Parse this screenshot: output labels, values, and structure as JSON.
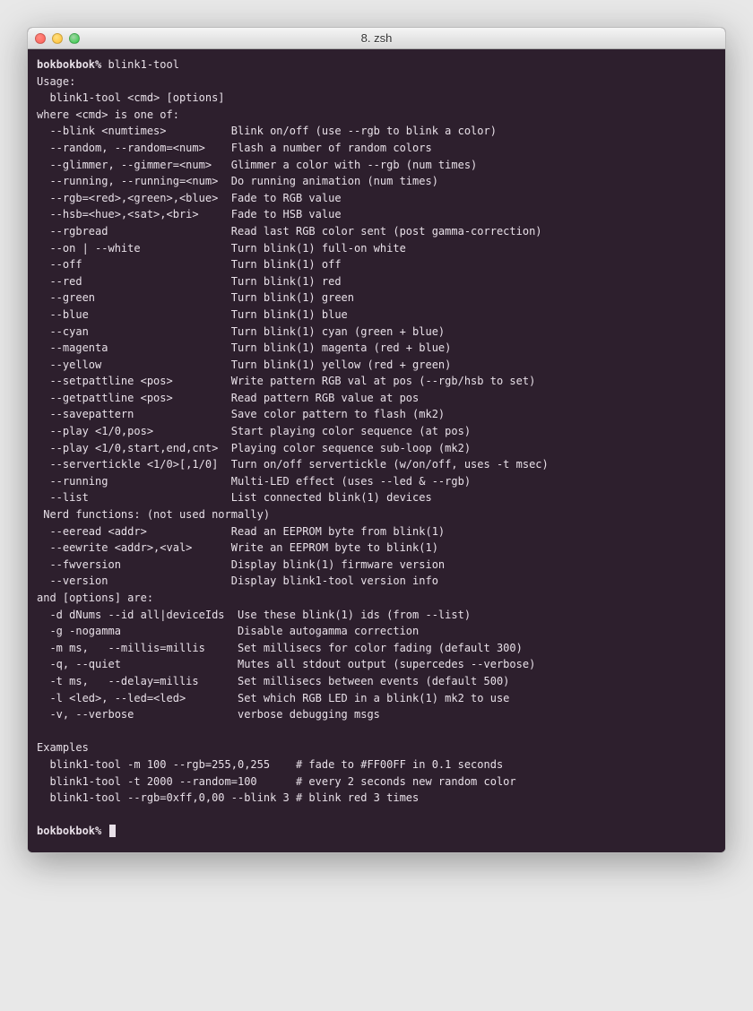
{
  "window": {
    "title": "8. zsh"
  },
  "prompt1": {
    "host": "bokbokbok%",
    "cmd": " blink1-tool"
  },
  "usage_header": "Usage:",
  "usage_line": "  blink1-tool <cmd> [options]",
  "where_header": "where <cmd> is one of:",
  "cmds": [
    {
      "flag": "  --blink <numtimes>        ",
      "desc": "Blink on/off (use --rgb to blink a color)"
    },
    {
      "flag": "  --random, --random=<num>  ",
      "desc": "Flash a number of random colors"
    },
    {
      "flag": "  --glimmer, --gimmer=<num> ",
      "desc": "Glimmer a color with --rgb (num times)"
    },
    {
      "flag": "  --running, --running=<num>",
      "desc": "Do running animation (num times)"
    },
    {
      "flag": "  --rgb=<red>,<green>,<blue>",
      "desc": "Fade to RGB value"
    },
    {
      "flag": "  --hsb=<hue>,<sat>,<bri>   ",
      "desc": "Fade to HSB value"
    },
    {
      "flag": "  --rgbread                 ",
      "desc": "Read last RGB color sent (post gamma-correction)"
    },
    {
      "flag": "  --on | --white            ",
      "desc": "Turn blink(1) full-on white"
    },
    {
      "flag": "  --off                     ",
      "desc": "Turn blink(1) off"
    },
    {
      "flag": "  --red                     ",
      "desc": "Turn blink(1) red"
    },
    {
      "flag": "  --green                   ",
      "desc": "Turn blink(1) green"
    },
    {
      "flag": "  --blue                    ",
      "desc": "Turn blink(1) blue"
    },
    {
      "flag": "  --cyan                    ",
      "desc": "Turn blink(1) cyan (green + blue)"
    },
    {
      "flag": "  --magenta                 ",
      "desc": "Turn blink(1) magenta (red + blue)"
    },
    {
      "flag": "  --yellow                  ",
      "desc": "Turn blink(1) yellow (red + green)"
    },
    {
      "flag": "  --setpattline <pos>       ",
      "desc": "Write pattern RGB val at pos (--rgb/hsb to set)"
    },
    {
      "flag": "  --getpattline <pos>       ",
      "desc": "Read pattern RGB value at pos"
    },
    {
      "flag": "  --savepattern             ",
      "desc": "Save color pattern to flash (mk2)"
    },
    {
      "flag": "  --play <1/0,pos>          ",
      "desc": "Start playing color sequence (at pos)"
    },
    {
      "flag": "  --play <1/0,start,end,cnt>",
      "desc": "Playing color sequence sub-loop (mk2)"
    },
    {
      "flag": "  --servertickle <1/0>[,1/0]",
      "desc": "Turn on/off servertickle (w/on/off, uses -t msec)"
    },
    {
      "flag": "  --running                 ",
      "desc": "Multi-LED effect (uses --led & --rgb)"
    },
    {
      "flag": "  --list                    ",
      "desc": "List connected blink(1) devices"
    }
  ],
  "nerd_header": " Nerd functions: (not used normally)",
  "nerd": [
    {
      "flag": "  --eeread <addr>           ",
      "desc": "Read an EEPROM byte from blink(1)"
    },
    {
      "flag": "  --eewrite <addr>,<val>    ",
      "desc": "Write an EEPROM byte to blink(1)"
    },
    {
      "flag": "  --fwversion               ",
      "desc": "Display blink(1) firmware version"
    },
    {
      "flag": "  --version                 ",
      "desc": "Display blink1-tool version info"
    }
  ],
  "options_header": "and [options] are:",
  "options": [
    {
      "flag": "  -d dNums --id all|deviceIds",
      "desc": "Use these blink(1) ids (from --list)"
    },
    {
      "flag": "  -g -nogamma               ",
      "desc": " Disable autogamma correction"
    },
    {
      "flag": "  -m ms,   --millis=millis  ",
      "desc": " Set millisecs for color fading (default 300)"
    },
    {
      "flag": "  -q, --quiet               ",
      "desc": " Mutes all stdout output (supercedes --verbose)"
    },
    {
      "flag": "  -t ms,   --delay=millis   ",
      "desc": " Set millisecs between events (default 500)"
    },
    {
      "flag": "  -l <led>, --led=<led>     ",
      "desc": " Set which RGB LED in a blink(1) mk2 to use"
    },
    {
      "flag": "  -v, --verbose             ",
      "desc": " verbose debugging msgs"
    }
  ],
  "examples_header": "Examples",
  "examples": [
    "  blink1-tool -m 100 --rgb=255,0,255    # fade to #FF00FF in 0.1 seconds",
    "  blink1-tool -t 2000 --random=100      # every 2 seconds new random color",
    "  blink1-tool --rgb=0xff,0,00 --blink 3 # blink red 3 times"
  ],
  "prompt2": {
    "host": "bokbokbok%"
  }
}
